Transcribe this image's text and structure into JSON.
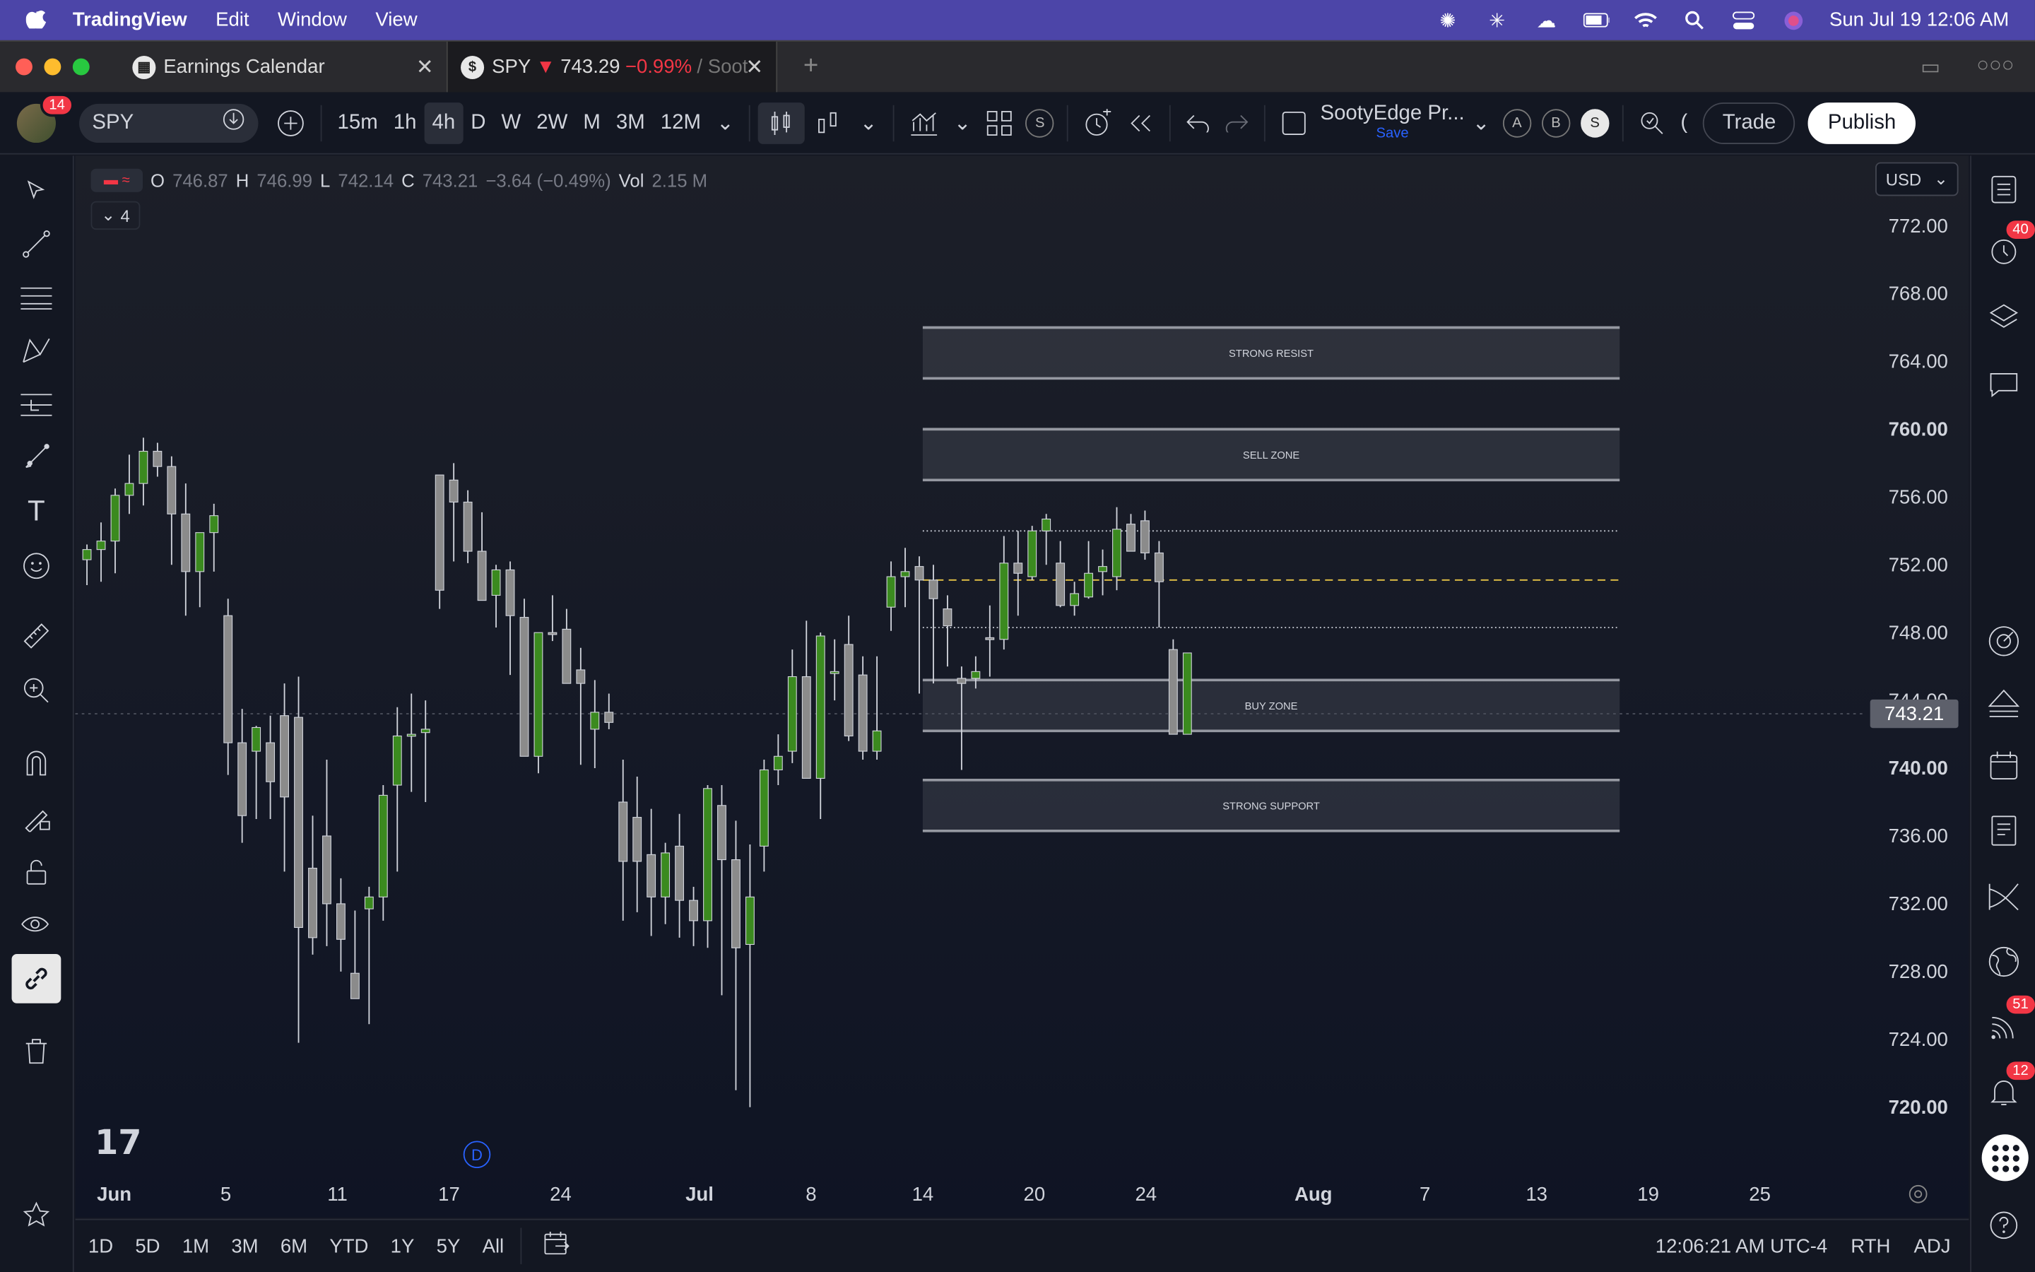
{
  "menubar": {
    "app_name": "TradingView",
    "menus": [
      "Edit",
      "Window",
      "View"
    ],
    "datetime": "Sun Jul 19  12:06 AM"
  },
  "tabs": {
    "tab1": "Earnings Calendar",
    "tab2_symbol": "SPY",
    "tab2_arrow": "▼",
    "tab2_price": "743.29",
    "tab2_change": "−0.99%",
    "tab2_suffix": "/ Soot"
  },
  "toolbar": {
    "avatar_badge": "14",
    "symbol": "SPY",
    "intervals": [
      "15m",
      "1h",
      "4h",
      "D",
      "W",
      "2W",
      "M",
      "3M",
      "12M"
    ],
    "active_interval": "4h",
    "layout_name": "SootyEdge Pr...",
    "layout_save": "Save",
    "chips": [
      "A",
      "B",
      "S"
    ],
    "indicators_chip": "S",
    "trade_label": "Trade",
    "publish_label": "Publish"
  },
  "legend": {
    "o_label": "O",
    "o": "746.87",
    "h_label": "H",
    "h": "746.99",
    "l_label": "L",
    "l": "742.14",
    "c_label": "C",
    "c": "743.21",
    "change": "−3.64 (−0.49%)",
    "vol_label": "Vol",
    "vol": "2.15 M",
    "collapse_count": "4"
  },
  "currency": "USD",
  "price_axis": {
    "ticks": [
      "772.00",
      "768.00",
      "764.00",
      "760.00",
      "756.00",
      "752.00",
      "748.00",
      "744.00",
      "740.00",
      "736.00",
      "732.00",
      "728.00",
      "724.00",
      "720.00"
    ],
    "current_price": "743.21"
  },
  "zones": [
    {
      "label": "STRONG RESIST",
      "top": 766,
      "bottom": 763
    },
    {
      "label": "SELL ZONE",
      "top": 760,
      "bottom": 757
    },
    {
      "label": "BUY ZONE",
      "top": 745.2,
      "bottom": 742.2
    },
    {
      "label": "STRONG SUPPORT",
      "top": 739.3,
      "bottom": 736.3
    }
  ],
  "levels": [
    {
      "price": 754.0,
      "style": "dotted",
      "color": "#cfd3dc"
    },
    {
      "price": 751.1,
      "style": "dashed",
      "color": "#e8c547"
    },
    {
      "price": 748.3,
      "style": "dotted",
      "color": "#cfd3dc"
    }
  ],
  "dmark": "D",
  "time_axis": {
    "labels": [
      "Jun",
      "5",
      "11",
      "17",
      "24",
      "Jul",
      "8",
      "14",
      "20",
      "24",
      "Aug",
      "7",
      "13",
      "19",
      "25"
    ]
  },
  "ranges": [
    "1D",
    "5D",
    "1M",
    "3M",
    "6M",
    "YTD",
    "1Y",
    "5Y",
    "All"
  ],
  "statusbar": {
    "clock": "12:06:21 AM UTC-4",
    "session": "RTH",
    "adj": "ADJ"
  },
  "right_badges": {
    "alerts": "40",
    "news": "51",
    "notifications": "12"
  },
  "colors": {
    "up": "#3b8a1f",
    "down": "#8b8b8b",
    "accent": "#2962ff",
    "alert_red": "#f23645"
  },
  "chart_data": {
    "type": "candlestick",
    "ylim": [
      717.5,
      775
    ],
    "candles": [
      [
        752.3,
        753.2,
        750.8,
        752.9
      ],
      [
        752.9,
        754.5,
        751.0,
        753.4
      ],
      [
        753.4,
        756.5,
        751.5,
        756.1
      ],
      [
        756.1,
        758.5,
        755.0,
        756.8
      ],
      [
        756.8,
        759.5,
        755.5,
        758.7
      ],
      [
        758.7,
        759.2,
        757.2,
        757.8
      ],
      [
        757.8,
        758.4,
        752.0,
        755.0
      ],
      [
        755.0,
        756.8,
        749.0,
        751.6
      ],
      [
        751.6,
        753.8,
        749.5,
        753.9
      ],
      [
        753.9,
        755.6,
        751.6,
        754.9
      ],
      [
        749.0,
        750.0,
        739.6,
        741.5
      ],
      [
        741.5,
        743.5,
        735.6,
        737.2
      ],
      [
        741.0,
        742.5,
        737.0,
        742.4
      ],
      [
        741.5,
        743.1,
        737.0,
        739.2
      ],
      [
        743.1,
        745.0,
        733.9,
        738.3
      ],
      [
        743.0,
        745.4,
        723.8,
        730.6
      ],
      [
        734.1,
        737.2,
        729.0,
        730.0
      ],
      [
        736.0,
        740.5,
        729.5,
        732.0
      ],
      [
        732.0,
        733.5,
        728.0,
        729.9
      ],
      [
        727.9,
        731.6,
        727.0,
        726.4
      ],
      [
        731.7,
        733.0,
        724.9,
        732.4
      ],
      [
        732.4,
        739.0,
        731.0,
        738.4
      ],
      [
        739.0,
        743.6,
        733.9,
        741.9
      ],
      [
        741.9,
        744.4,
        738.6,
        742.0
      ],
      [
        742.1,
        744.0,
        738.0,
        742.3
      ],
      [
        757.3,
        757.0,
        749.4,
        750.5
      ],
      [
        757.0,
        758.0,
        752.2,
        755.7
      ],
      [
        755.7,
        756.4,
        752.1,
        752.8
      ],
      [
        752.8,
        755.1,
        750.7,
        749.9
      ],
      [
        750.2,
        752.0,
        748.3,
        751.7
      ],
      [
        751.7,
        752.2,
        745.5,
        749.0
      ],
      [
        748.9,
        750.0,
        741.8,
        740.7
      ],
      [
        740.7,
        746.3,
        739.7,
        748.0
      ],
      [
        748.0,
        750.2,
        747.5,
        747.9
      ],
      [
        748.2,
        749.4,
        746.0,
        745.0
      ],
      [
        745.8,
        747.1,
        740.2,
        745.0
      ],
      [
        742.3,
        745.2,
        740.0,
        743.3
      ],
      [
        743.3,
        744.4,
        742.3,
        742.7
      ],
      [
        738.0,
        740.5,
        731.0,
        734.5
      ],
      [
        737.1,
        739.5,
        731.5,
        734.5
      ],
      [
        734.9,
        737.6,
        730.1,
        732.4
      ],
      [
        732.4,
        735.6,
        730.8,
        735.0
      ],
      [
        735.4,
        737.3,
        730.0,
        732.2
      ],
      [
        732.2,
        733.0,
        729.5,
        731.0
      ],
      [
        731.0,
        739.0,
        729.4,
        738.8
      ],
      [
        737.8,
        739.0,
        726.6,
        734.6
      ],
      [
        734.6,
        736.9,
        721.0,
        729.4
      ],
      [
        729.6,
        735.5,
        720.0,
        732.4
      ],
      [
        735.4,
        740.5,
        733.9,
        739.9
      ],
      [
        739.9,
        742.0,
        739.0,
        740.7
      ],
      [
        741.0,
        747.0,
        740.3,
        745.4
      ],
      [
        745.4,
        748.7,
        741.2,
        739.4
      ],
      [
        739.4,
        748.0,
        737.0,
        747.8
      ],
      [
        745.6,
        747.6,
        744.0,
        745.7
      ],
      [
        747.3,
        749.0,
        741.6,
        741.9
      ],
      [
        745.5,
        746.6,
        740.5,
        741.0
      ],
      [
        741.0,
        746.6,
        740.5,
        742.2
      ],
      [
        749.5,
        752.2,
        748.1,
        751.3
      ],
      [
        751.3,
        753.0,
        749.5,
        751.6
      ],
      [
        751.9,
        752.5,
        744.4,
        751.1
      ],
      [
        751.1,
        752.0,
        745.0,
        750.0
      ],
      [
        749.4,
        750.2,
        746.0,
        748.4
      ],
      [
        745.3,
        746.0,
        739.9,
        745.0
      ],
      [
        745.3,
        746.6,
        744.7,
        745.7
      ],
      [
        747.7,
        749.6,
        745.4,
        747.6
      ],
      [
        747.6,
        753.7,
        747.0,
        752.1
      ],
      [
        752.1,
        754.0,
        749.0,
        751.5
      ],
      [
        751.3,
        754.3,
        751.1,
        754.0
      ],
      [
        754.0,
        755.0,
        752.0,
        754.7
      ],
      [
        752.1,
        753.4,
        749.5,
        749.6
      ],
      [
        749.6,
        751.0,
        749.0,
        750.3
      ],
      [
        750.1,
        753.4,
        750.0,
        751.5
      ],
      [
        751.6,
        752.9,
        750.2,
        751.9
      ],
      [
        751.3,
        755.4,
        750.5,
        754.1
      ],
      [
        754.4,
        755.0,
        752.8,
        752.8
      ],
      [
        754.6,
        755.2,
        752.3,
        752.7
      ],
      [
        752.7,
        753.4,
        748.3,
        751.0
      ],
      [
        747.0,
        747.6,
        742.0,
        742.0
      ],
      [
        742.0,
        746.7,
        742.0,
        746.8
      ]
    ]
  }
}
